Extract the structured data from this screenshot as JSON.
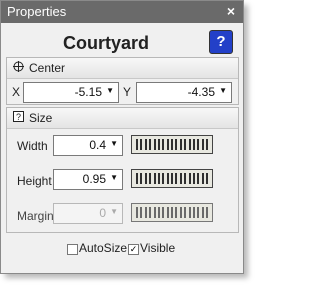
{
  "window": {
    "title": "Properties",
    "close": "×"
  },
  "object": {
    "name": "Courtyard",
    "help": "?"
  },
  "center": {
    "header": "Center",
    "x_label": "X",
    "x_value": "-5.15",
    "y_label": "Y",
    "y_value": "-4.35"
  },
  "size": {
    "header": "Size",
    "width_label": "Width",
    "width_value": "0.4",
    "height_label": "Height",
    "height_value": "0.95",
    "margin_label": "Margin",
    "margin_value": "0"
  },
  "footer": {
    "autosize_label": "AutoSize",
    "autosize_checked": false,
    "visible_label": "Visible",
    "visible_checked": true,
    "check_mark": "✓"
  }
}
